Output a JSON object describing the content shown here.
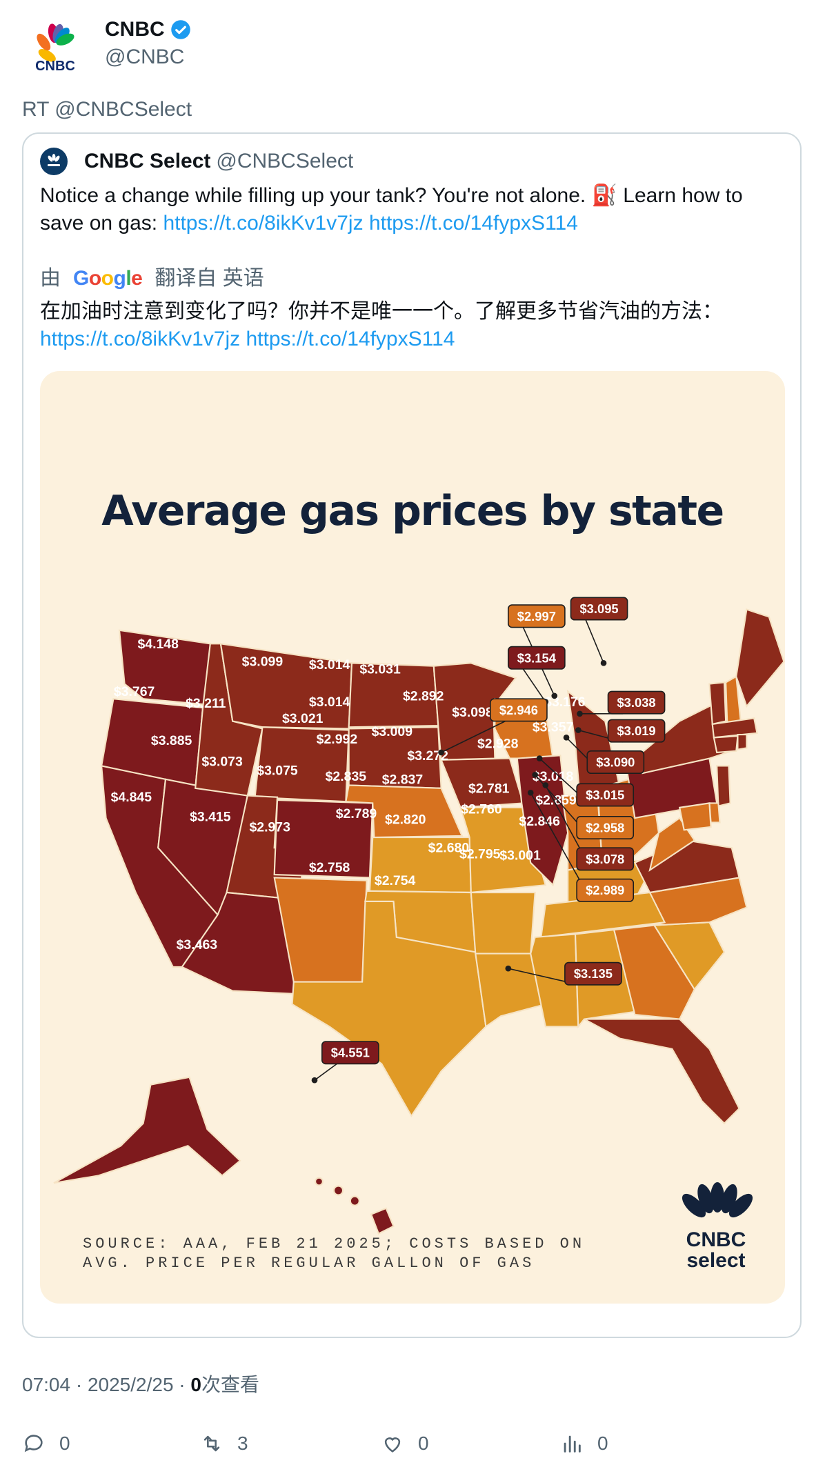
{
  "author": {
    "name": "CNBC",
    "handle": "@CNBC",
    "verified": true,
    "avatar_icon": "cnbc-peacock-logo"
  },
  "retweet_line": "RT @CNBCSelect",
  "quoted": {
    "name": "CNBC Select",
    "handle": "@CNBCSelect",
    "text_before_links": "Notice a change while filling up your tank? You're not alone. ⛽ Learn how to save on gas: ",
    "link1": "https://t.co/8ikKv1v7jz",
    "link2": "https://t.co/14fypxS114",
    "translate_prefix": "由",
    "translate_brand": "Google",
    "translate_suffix": "翻译自 英语",
    "translated_text": "在加油时注意到变化了吗？你并不是唯一一个。了解更多节省汽油的方法：",
    "translated_link1": "https://t.co/8ikKv1v7jz",
    "translated_link2": "https://t.co/14fypxS114"
  },
  "infographic": {
    "title": "Average gas prices by state",
    "source_line1": "SOURCE: AAA, FEB 21 2025; COSTS BASED ON",
    "source_line2": "AVG. PRICE PER REGULAR GALLON OF GAS",
    "logo_line1": "CNBC",
    "logo_line2": "select",
    "colors": {
      "dark": "#7e1a1d",
      "red": "#8c2a1b",
      "orange": "#d7721f",
      "gold": "#e09a26",
      "background": "#fcf1dd"
    },
    "prices": {
      "WA": "$4.148",
      "OR": "$3.767",
      "CA": "$4.845",
      "NV": "$3.885",
      "ID": "$3.211",
      "MT": "$3.099",
      "WY": "$3.021",
      "UT": "$3.073",
      "AZ": "$3.415",
      "CO": "$3.075",
      "NM": "$2.973",
      "ND": "$3.014",
      "SD": "$3.014",
      "NE": "$2.992",
      "KS": "$2.835",
      "OK": "$2.789",
      "TX": "$2.758",
      "MN": "$3.031",
      "IA": "$3.009",
      "MO": "$2.837",
      "AR": "$2.820",
      "LA": "$2.754",
      "WI": "$2.892",
      "IL": "$3.272",
      "MI": "$3.098",
      "IN": "$2.946",
      "OH": "$2.928",
      "KY": "$2.781",
      "TN": "$2.760",
      "MS": "$2.680",
      "AL": "$2.795",
      "GA": "$3.001",
      "FL": "$3.135",
      "SC": "$2.846",
      "NC": "$2.859",
      "VA": "$3.018",
      "WV": "$3.078",
      "PA": "$3.357",
      "NY": "$3.176",
      "VT": "$3.154",
      "NH": "$2.997",
      "ME": "$3.095",
      "MA": "$3.038",
      "RI": "$3.019",
      "CT": "$3.090",
      "NJ": "$3.015",
      "DE": "$2.958",
      "MD": "$2.989",
      "AK": "$3.463",
      "HI": "$4.551"
    }
  },
  "meta": {
    "time": "07:04 · 2025/2/25 · ",
    "views": "0",
    "views_label": "次查看"
  },
  "actions": {
    "replies": "0",
    "retweets": "3",
    "likes": "0",
    "views": "0"
  }
}
